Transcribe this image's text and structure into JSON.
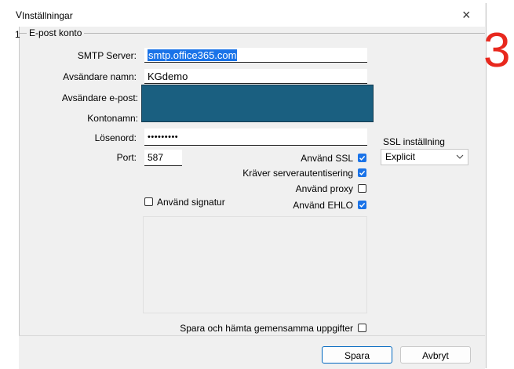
{
  "window": {
    "title": "Inställningar",
    "close_glyph": "×"
  },
  "edge_glyphs": [
    "V",
    "1"
  ],
  "group": {
    "legend": "E-post konto"
  },
  "fields": {
    "smtp_label": "SMTP Server:",
    "smtp_value": "smtp.office365.com",
    "sender_name_label": "Avsändare namn:",
    "sender_name_value": "KGdemo",
    "sender_email_label": "Avsändare e-post:",
    "account_label": "Kontonamn:",
    "password_label": "Lösenord:",
    "password_value": "•••••••••",
    "port_label": "Port:",
    "port_value": "587"
  },
  "options": {
    "use_ssl": {
      "label": "Använd SSL",
      "checked": true
    },
    "requires_auth": {
      "label": "Kräver serverautentisering",
      "checked": true
    },
    "use_proxy": {
      "label": "Använd proxy",
      "checked": false
    },
    "use_signature": {
      "label": "Använd signatur",
      "checked": false
    },
    "use_ehlo": {
      "label": "Använd EHLO",
      "checked": true
    },
    "save_shared": {
      "label": "Spara och hämta gemensamma uppgifter",
      "checked": false
    }
  },
  "ssl": {
    "label": "SSL inställning",
    "selected": "Explicit"
  },
  "buttons": {
    "save": "Spara",
    "cancel": "Avbryt"
  },
  "annotation": {
    "number": "3",
    "color": "#e8281e"
  },
  "colors": {
    "accent": "#1a73e8",
    "redaction": "#1a5f80"
  }
}
